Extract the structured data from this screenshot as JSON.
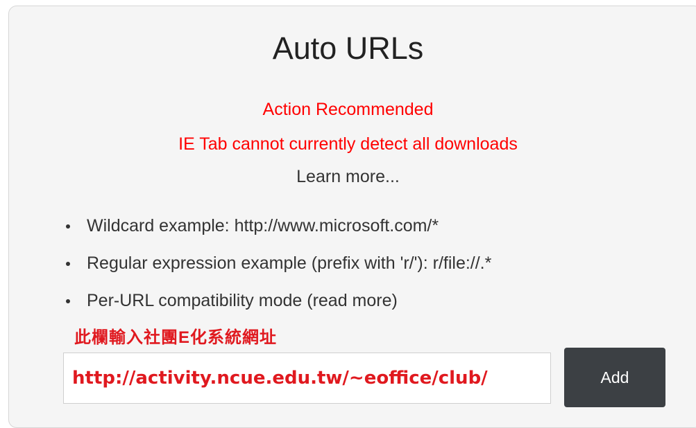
{
  "title": "Auto URLs",
  "warning": {
    "line1": "Action Recommended",
    "line2": "IE Tab cannot currently detect all downloads"
  },
  "learn_more": "Learn more...",
  "tips": [
    {
      "text": "Wildcard example: http://www.microsoft.com/*"
    },
    {
      "text": "Regular expression example (prefix with 'r/'): r/file://.*"
    },
    {
      "text": "Per-URL compatibility mode ",
      "link": "(read more)"
    }
  ],
  "annotation": "此欄輸入社團E化系統網址",
  "url_input": {
    "value": "http://activity.ncue.edu.tw/~eoffice/club/"
  },
  "add_button": "Add",
  "colors": {
    "warning": "#ff0000",
    "annotation": "#e0191f",
    "button_bg": "#3c4044",
    "panel_bg": "#f5f5f5"
  }
}
